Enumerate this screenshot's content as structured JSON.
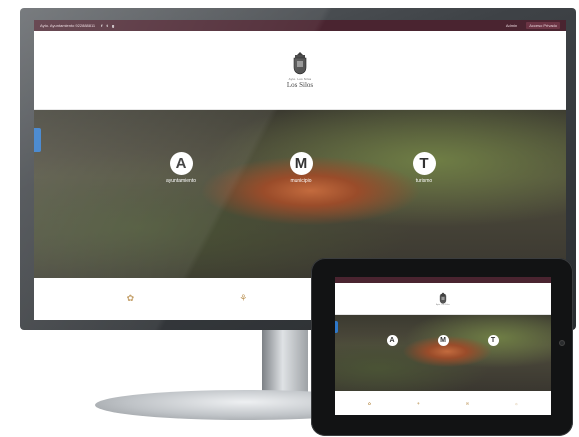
{
  "site": {
    "topbar": {
      "info": "Ayto. Ayuntamiento 922888811",
      "social": [
        "f",
        "t",
        "g"
      ],
      "actions": [
        "Admin",
        "Acceso Privado"
      ]
    },
    "brand": {
      "small": "Ayto. Los Silos",
      "name": "Los Silos"
    },
    "hero": {
      "links": [
        {
          "letter": "A",
          "label": "ayuntamiento"
        },
        {
          "letter": "M",
          "label": "municipio"
        },
        {
          "letter": "T",
          "label": "turismo"
        }
      ]
    },
    "icons": [
      "✿",
      "⚘",
      "✉",
      "☼"
    ]
  },
  "colors": {
    "topbar": "#4a2430",
    "accent_blue": "#2f78c9",
    "monitor_frame": "#2a2d30",
    "tablet_frame": "#121314"
  }
}
